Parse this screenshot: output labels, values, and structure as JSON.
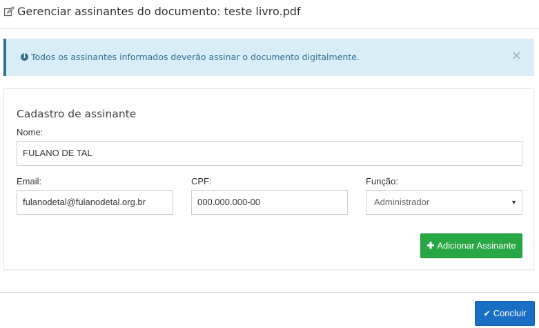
{
  "header": {
    "title": "Gerenciar assinantes do documento: teste livro.pdf",
    "icon": "edit-icon"
  },
  "alert": {
    "text": "Todos os assinantes informados deverão assinar o documento digitalmente.",
    "icon": "info-circle-icon",
    "close_symbol": "×"
  },
  "form": {
    "title": "Cadastro de assinante",
    "name_label": "Nome:",
    "name_value": "FULANO DE TAL",
    "email_label": "Email:",
    "email_value": "fulanodetal@fulanodetal.org.br",
    "cpf_label": "CPF:",
    "cpf_value": "000.000.000-00",
    "role_label": "Função:",
    "role_value": "Administrador",
    "add_button_label": "Adicionar Assinante"
  },
  "footer": {
    "done_button_label": "Concluir"
  },
  "colors": {
    "alert_bg": "#d9edf7",
    "alert_text": "#31708f",
    "success": "#28a745",
    "primary": "#1a6fc4"
  }
}
